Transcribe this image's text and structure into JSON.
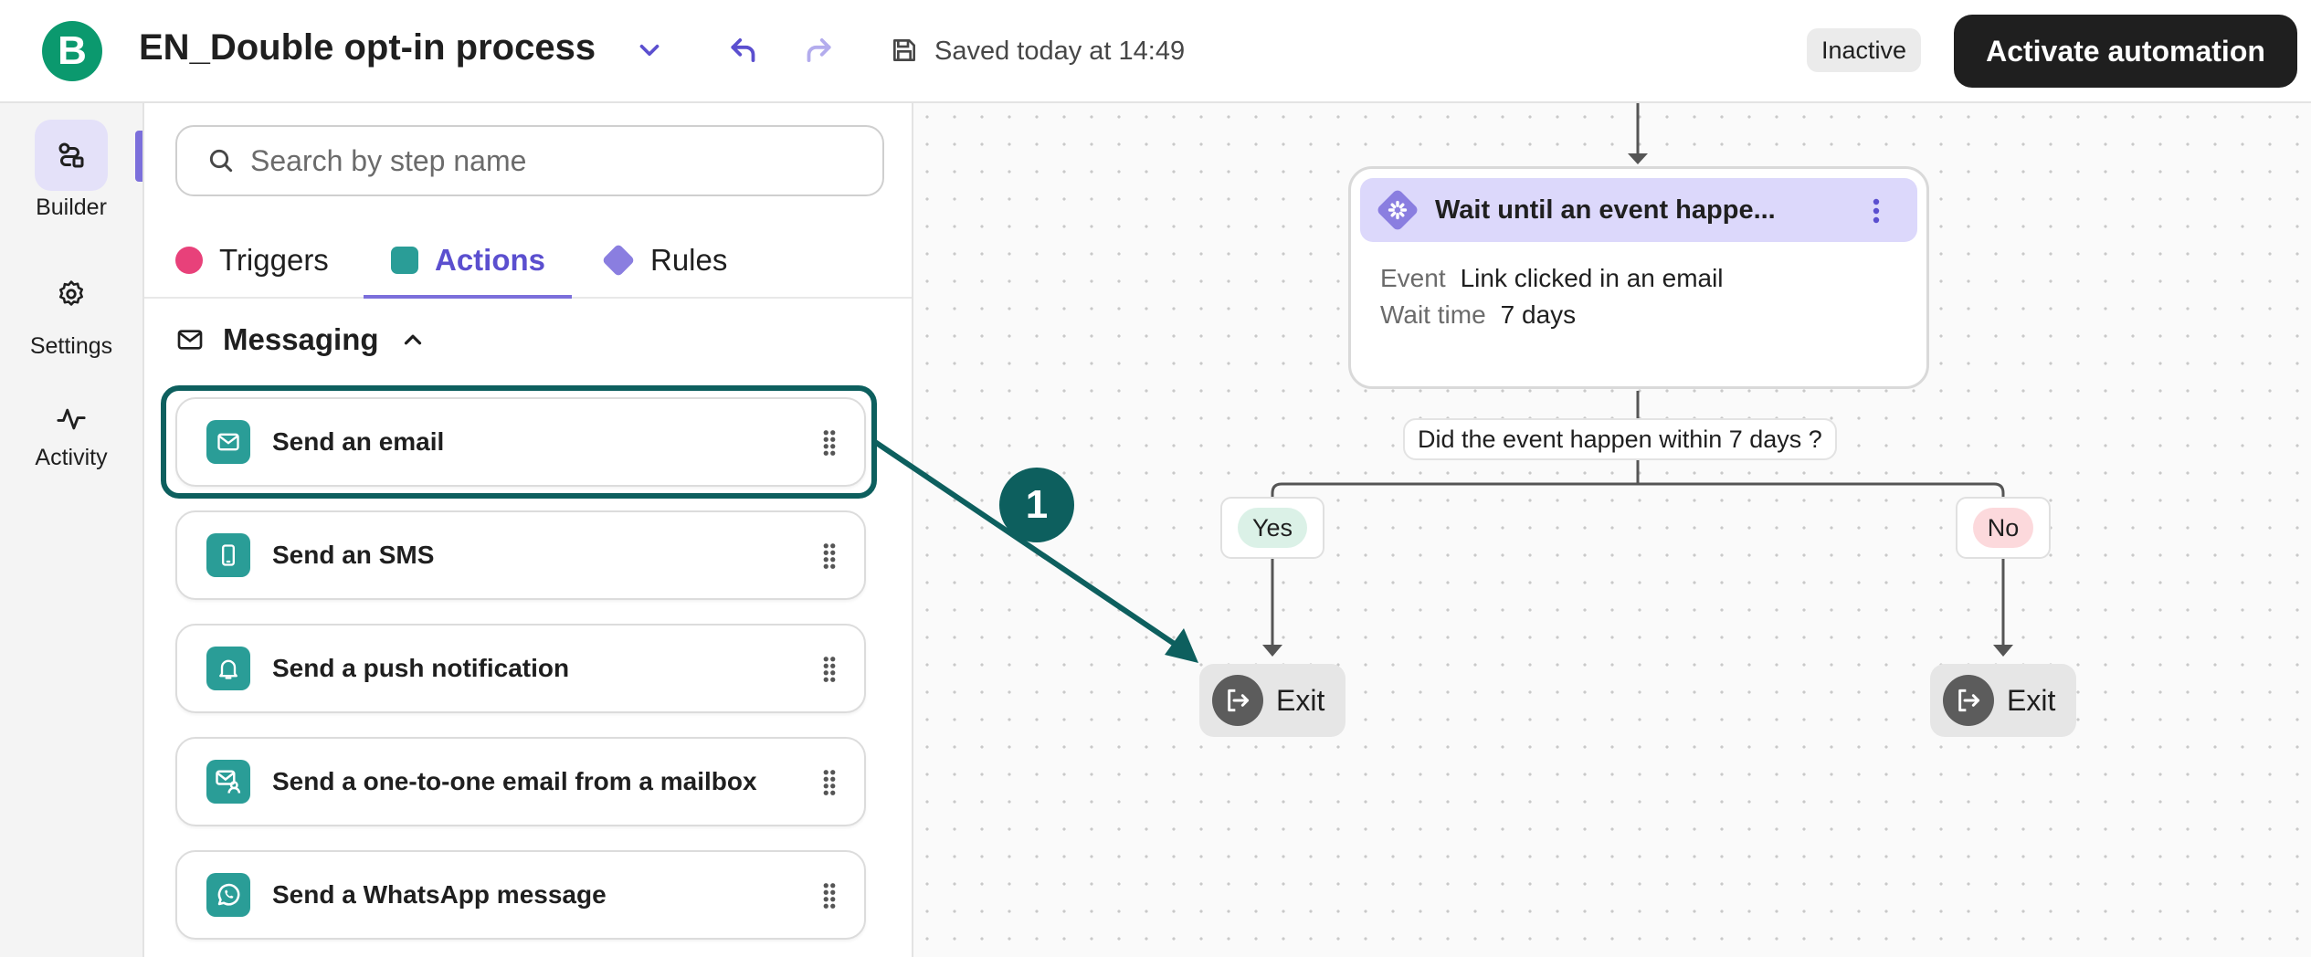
{
  "header": {
    "logo_letter": "B",
    "title": "EN_Double opt-in process",
    "saved_text": "Saved today at 14:49",
    "status": "Inactive",
    "activate_label": "Activate automation"
  },
  "rail": {
    "items": [
      {
        "label": "Builder",
        "icon": "builder-icon",
        "active": true
      },
      {
        "label": "Settings",
        "icon": "gear-icon",
        "active": false
      },
      {
        "label": "Activity",
        "icon": "activity-icon",
        "active": false
      }
    ]
  },
  "panel": {
    "search_placeholder": "Search by step name",
    "tabs": [
      {
        "label": "Triggers",
        "active": false
      },
      {
        "label": "Actions",
        "active": true
      },
      {
        "label": "Rules",
        "active": false
      }
    ],
    "section": "Messaging",
    "steps": [
      {
        "label": "Send an email",
        "icon": "mail-icon",
        "highlighted": true
      },
      {
        "label": "Send an SMS",
        "icon": "phone-icon"
      },
      {
        "label": "Send a push notification",
        "icon": "bell-icon"
      },
      {
        "label": "Send a one-to-one email from a mailbox",
        "icon": "mailbox-user-icon"
      },
      {
        "label": "Send a WhatsApp message",
        "icon": "whatsapp-icon"
      }
    ]
  },
  "canvas": {
    "wait_card": {
      "title": "Wait until an event happe...",
      "event_key": "Event",
      "event_value": "Link clicked in an email",
      "wait_key": "Wait time",
      "wait_value": "7 days"
    },
    "condition": "Did the event happen within 7 days ?",
    "yes_label": "Yes",
    "no_label": "No",
    "exit_label": "Exit",
    "marker": "1"
  },
  "colors": {
    "brand": "#0b996e",
    "accent_purple": "#7b6fdb",
    "teal": "#2a9d97",
    "highlight": "#0d5f5e",
    "trigger_pink": "#e8417a"
  }
}
